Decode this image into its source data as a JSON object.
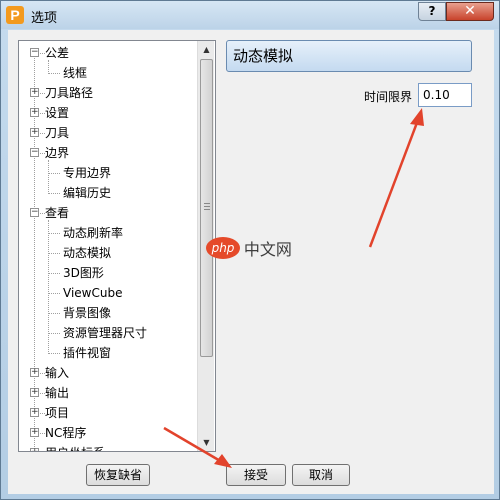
{
  "window": {
    "title": "选项",
    "app_icon_letter": "P",
    "help": "?",
    "close": "✕"
  },
  "tree": {
    "items": [
      {
        "label": "公差",
        "toggle": "−"
      },
      {
        "label": "线框",
        "toggle": ""
      },
      {
        "label": "刀具路径",
        "toggle": "+"
      },
      {
        "label": "设置",
        "toggle": "+"
      },
      {
        "label": "刀具",
        "toggle": "+"
      },
      {
        "label": "边界",
        "toggle": "−"
      },
      {
        "label": "专用边界",
        "toggle": ""
      },
      {
        "label": "编辑历史",
        "toggle": ""
      },
      {
        "label": "查看",
        "toggle": "−"
      },
      {
        "label": "动态刷新率",
        "toggle": ""
      },
      {
        "label": "动态模拟",
        "toggle": ""
      },
      {
        "label": "3D图形",
        "toggle": ""
      },
      {
        "label": "ViewCube",
        "toggle": ""
      },
      {
        "label": "背景图像",
        "toggle": ""
      },
      {
        "label": "资源管理器尺寸",
        "toggle": ""
      },
      {
        "label": "插件视窗",
        "toggle": ""
      },
      {
        "label": "输入",
        "toggle": "+"
      },
      {
        "label": "输出",
        "toggle": "+"
      },
      {
        "label": "项目",
        "toggle": "+"
      },
      {
        "label": "NC程序",
        "toggle": "+"
      },
      {
        "label": "用户坐标系",
        "toggle": "+"
      }
    ],
    "scroll_up": "▲",
    "scroll_down": "▼"
  },
  "panel": {
    "title": "动态模拟",
    "time_limit_label": "时间限界",
    "time_limit_value": "0.10"
  },
  "buttons": {
    "restore": "恢复缺省",
    "accept": "接受",
    "cancel": "取消"
  },
  "watermark": {
    "logo": "php",
    "text": "中文网"
  },
  "annotation_color": "#e2432c"
}
